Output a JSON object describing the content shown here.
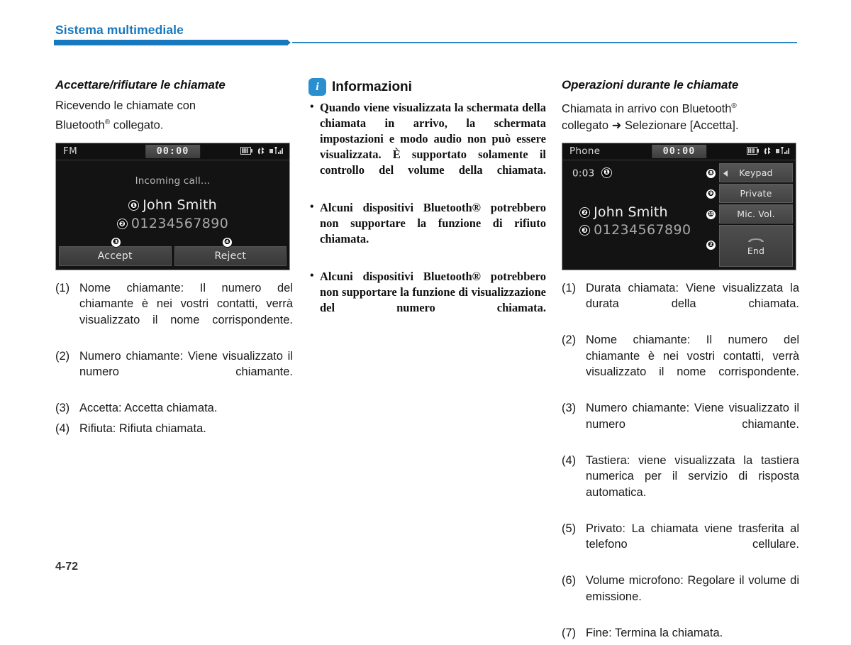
{
  "header": {
    "title": "Sistema multimediale",
    "accent_color": "#1878be"
  },
  "footer": {
    "page_number": "4-72"
  },
  "left_column": {
    "heading": "Accettare/rifiutare le chiamate",
    "intro_line1": "Ricevendo le chiamate con",
    "intro_line2_pre": "Bluetooth",
    "intro_line2_post": " collegato.",
    "device": {
      "source_label": "FM",
      "clock": "00:00",
      "icons": [
        "battery-icon",
        "bluetooth-phone-icon",
        "signal-icon"
      ],
      "status_text": "Incoming call...",
      "caller_name": "John Smith",
      "caller_number": "01234567890",
      "badge_name": "❶",
      "badge_number": "❷",
      "accept_label": "Accept",
      "reject_label": "Reject",
      "badge_accept": "❸",
      "badge_reject": "❹"
    },
    "captions": [
      {
        "num": "(1)",
        "text": "Nome chiamante: Il numero del chiamante è nei vostri contatti, verrà visualizzato il nome corrispondente."
      },
      {
        "num": "(2)",
        "text": "Numero chiamante: Viene visualizzato il numero chiamante."
      },
      {
        "num": "(3)",
        "text": "Accetta: Accetta chiamata."
      },
      {
        "num": "(4)",
        "text": "Rifiuta: Rifiuta chiamata."
      }
    ]
  },
  "middle_column": {
    "info_title": "Informazioni",
    "info_icon": "info-icon",
    "info_icon_letter": "i",
    "bullets": [
      "Quando viene visualizzata la schermata della chiamata in arrivo, la schermata impostazioni e modo audio non può essere visualizzata. È supportato solamente il controllo del volume della chiamata.",
      "Alcuni dispositivi Bluetooth® potrebbero non supportare la funzione di rifiuto chiamata.",
      "Alcuni dispositivi Bluetooth® potrebbero non supportare la funzione di visualizzazione del numero chiamata."
    ]
  },
  "right_column": {
    "heading": "Operazioni durante le chiamate",
    "intro_line1_pre": "Chiamata in arrivo con Bluetooth",
    "intro_line2": "collegato ➜ Selezionare [Accetta].",
    "device": {
      "source_label": "Phone",
      "clock": "00:00",
      "icons": [
        "battery-icon",
        "bluetooth-phone-icon",
        "signal-icon"
      ],
      "call_duration": "0:03",
      "badge_duration": "❶",
      "caller_name": "John Smith",
      "caller_number": "01234567890",
      "badge_name": "❷",
      "badge_number": "❸",
      "keypad_label": "Keypad",
      "private_label": "Private",
      "mic_vol_label": "Mic. Vol.",
      "end_label": "End",
      "end_icon": "hangup-phone-icon",
      "badge_keypad": "❽",
      "badge_private": "❾",
      "badge_mic_vol": "❿",
      "badge_end": "⓼"
    },
    "captions": [
      {
        "num": "(1)",
        "text": "Durata chiamata: Viene visualizzata la durata della chiamata."
      },
      {
        "num": "(2)",
        "text": "Nome chiamante: Il numero del chiamante è nei vostri contatti, verrà visualizzato il nome corrispondente."
      },
      {
        "num": "(3)",
        "text": "Numero chiamante: Viene visualizzato il numero chiamante."
      },
      {
        "num": "(4)",
        "text": "Tastiera: viene visualizzata la tastiera numerica per il servizio di risposta automatica."
      },
      {
        "num": "(5)",
        "text": "Privato: La chiamata viene trasferita al telefono cellulare."
      },
      {
        "num": "(6)",
        "text": "Volume microfono: Regolare il volume di emissione."
      },
      {
        "num": "(7)",
        "text": "Fine: Termina la chiamata."
      }
    ]
  }
}
